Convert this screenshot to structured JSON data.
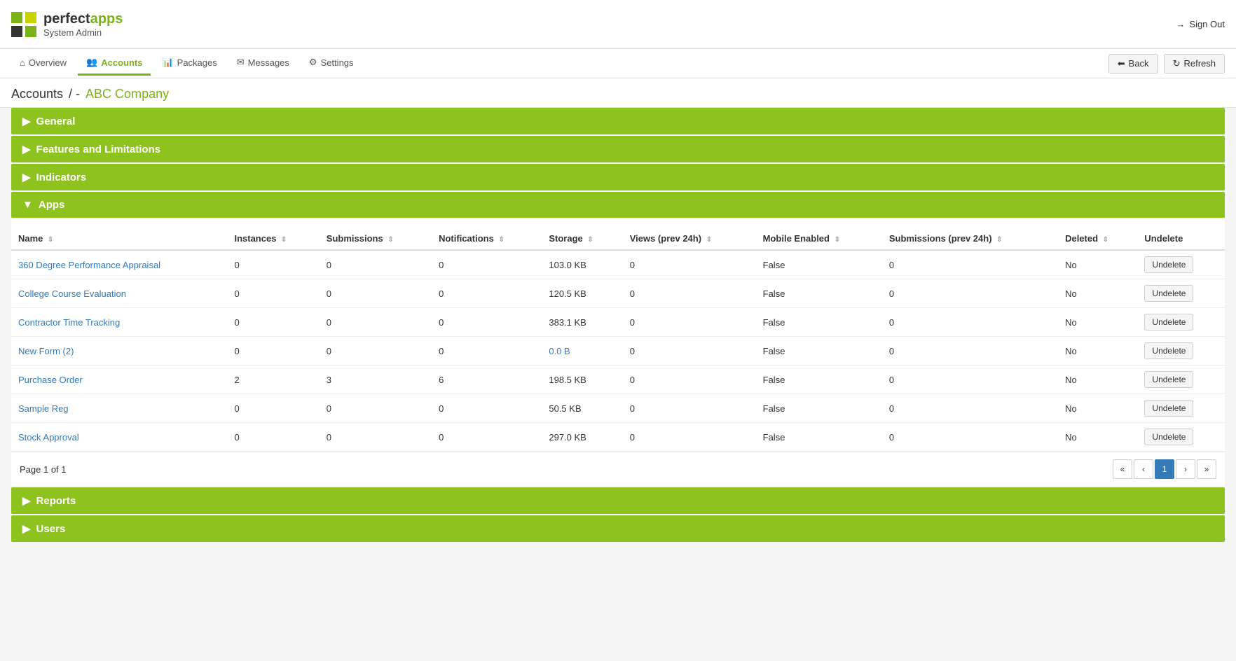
{
  "app": {
    "logo_perfect": "perfect",
    "logo_apps": "apps",
    "logo_sub": "System Admin",
    "sign_out_label": "Sign Out"
  },
  "nav": {
    "items": [
      {
        "id": "overview",
        "label": "Overview",
        "icon": "home",
        "active": false
      },
      {
        "id": "accounts",
        "label": "Accounts",
        "icon": "users",
        "active": true
      },
      {
        "id": "packages",
        "label": "Packages",
        "icon": "bar-chart",
        "active": false
      },
      {
        "id": "messages",
        "label": "Messages",
        "icon": "envelope",
        "active": false
      },
      {
        "id": "settings",
        "label": "Settings",
        "icon": "gear",
        "active": false
      }
    ],
    "back_label": "Back",
    "refresh_label": "Refresh"
  },
  "breadcrumb": {
    "section": "Accounts",
    "separator": "/  -",
    "company": "ABC Company"
  },
  "sections": [
    {
      "id": "general",
      "label": "General",
      "expanded": false
    },
    {
      "id": "features",
      "label": "Features and Limitations",
      "expanded": false
    },
    {
      "id": "indicators",
      "label": "Indicators",
      "expanded": false
    },
    {
      "id": "apps",
      "label": "Apps",
      "expanded": true
    },
    {
      "id": "reports",
      "label": "Reports",
      "expanded": false
    },
    {
      "id": "users",
      "label": "Users",
      "expanded": false
    }
  ],
  "apps_table": {
    "columns": [
      {
        "id": "name",
        "label": "Name"
      },
      {
        "id": "instances",
        "label": "Instances"
      },
      {
        "id": "submissions",
        "label": "Submissions"
      },
      {
        "id": "notifications",
        "label": "Notifications"
      },
      {
        "id": "storage",
        "label": "Storage"
      },
      {
        "id": "views",
        "label": "Views (prev 24h)"
      },
      {
        "id": "mobile_enabled",
        "label": "Mobile Enabled"
      },
      {
        "id": "submissions_24h",
        "label": "Submissions (prev 24h)"
      },
      {
        "id": "deleted",
        "label": "Deleted"
      },
      {
        "id": "undelete",
        "label": "Undelete"
      }
    ],
    "rows": [
      {
        "name": "360 Degree Performance Appraisal",
        "instances": "0",
        "submissions": "0",
        "notifications": "0",
        "storage": "103.0 KB",
        "views": "0",
        "mobile_enabled": "False",
        "submissions_24h": "0",
        "deleted": "No",
        "storage_blue": false
      },
      {
        "name": "College Course Evaluation",
        "instances": "0",
        "submissions": "0",
        "notifications": "0",
        "storage": "120.5 KB",
        "views": "0",
        "mobile_enabled": "False",
        "submissions_24h": "0",
        "deleted": "No",
        "storage_blue": false
      },
      {
        "name": "Contractor Time Tracking",
        "instances": "0",
        "submissions": "0",
        "notifications": "0",
        "storage": "383.1 KB",
        "views": "0",
        "mobile_enabled": "False",
        "submissions_24h": "0",
        "deleted": "No",
        "storage_blue": false
      },
      {
        "name": "New Form (2)",
        "instances": "0",
        "submissions": "0",
        "notifications": "0",
        "storage": "0.0 B",
        "views": "0",
        "mobile_enabled": "False",
        "submissions_24h": "0",
        "deleted": "No",
        "storage_blue": true
      },
      {
        "name": "Purchase Order",
        "instances": "2",
        "submissions": "3",
        "notifications": "6",
        "storage": "198.5 KB",
        "views": "0",
        "mobile_enabled": "False",
        "submissions_24h": "0",
        "deleted": "No",
        "storage_blue": false
      },
      {
        "name": "Sample Reg",
        "instances": "0",
        "submissions": "0",
        "notifications": "0",
        "storage": "50.5 KB",
        "views": "0",
        "mobile_enabled": "False",
        "submissions_24h": "0",
        "deleted": "No",
        "storage_blue": false
      },
      {
        "name": "Stock Approval",
        "instances": "0",
        "submissions": "0",
        "notifications": "0",
        "storage": "297.0 KB",
        "views": "0",
        "mobile_enabled": "False",
        "submissions_24h": "0",
        "deleted": "No",
        "storage_blue": false
      }
    ],
    "undelete_label": "Undelete",
    "page_info": "Page 1 of 1",
    "pagination": {
      "first": "«",
      "prev": "‹",
      "current": "1",
      "next": "›",
      "last": "»"
    }
  }
}
